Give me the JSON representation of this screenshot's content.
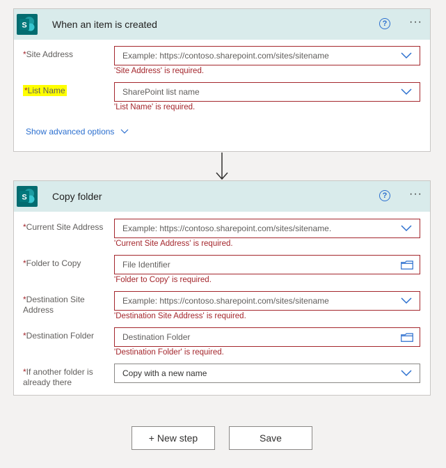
{
  "trigger": {
    "title": "When an item is created",
    "help": "?",
    "fields": [
      {
        "label": "Site Address",
        "placeholder": "Example: https://contoso.sharepoint.com/sites/sitename",
        "error": "'Site Address' is required."
      },
      {
        "label": "List Name",
        "placeholder": "SharePoint list name",
        "error": "'List Name' is required."
      }
    ],
    "advanced": "Show advanced options"
  },
  "action": {
    "title": "Copy folder",
    "help": "?",
    "fields": [
      {
        "label": "Current Site Address",
        "placeholder": "Example: https://contoso.sharepoint.com/sites/sitename.",
        "error": "'Current Site Address' is required."
      },
      {
        "label": "Folder to Copy",
        "placeholder": "File Identifier",
        "error": "'Folder to Copy' is required."
      },
      {
        "label_line1": "Destination Site",
        "label_line2": "Address",
        "placeholder": "Example: https://contoso.sharepoint.com/sites/sitename",
        "error": "'Destination Site Address' is required."
      },
      {
        "label": "Destination Folder",
        "placeholder": "Destination Folder",
        "error": "'Destination Folder' is required."
      },
      {
        "label_line1": "If another folder is",
        "label_line2": "already there",
        "value": "Copy with a new name"
      }
    ]
  },
  "buttons": {
    "new_step": "+ New step",
    "save": "Save"
  },
  "colors": {
    "header_bg": "#d9ebeb",
    "sharepoint": "#036c70",
    "error": "#a4262c",
    "link": "#2b6fcf",
    "highlight": "#ffff00"
  }
}
